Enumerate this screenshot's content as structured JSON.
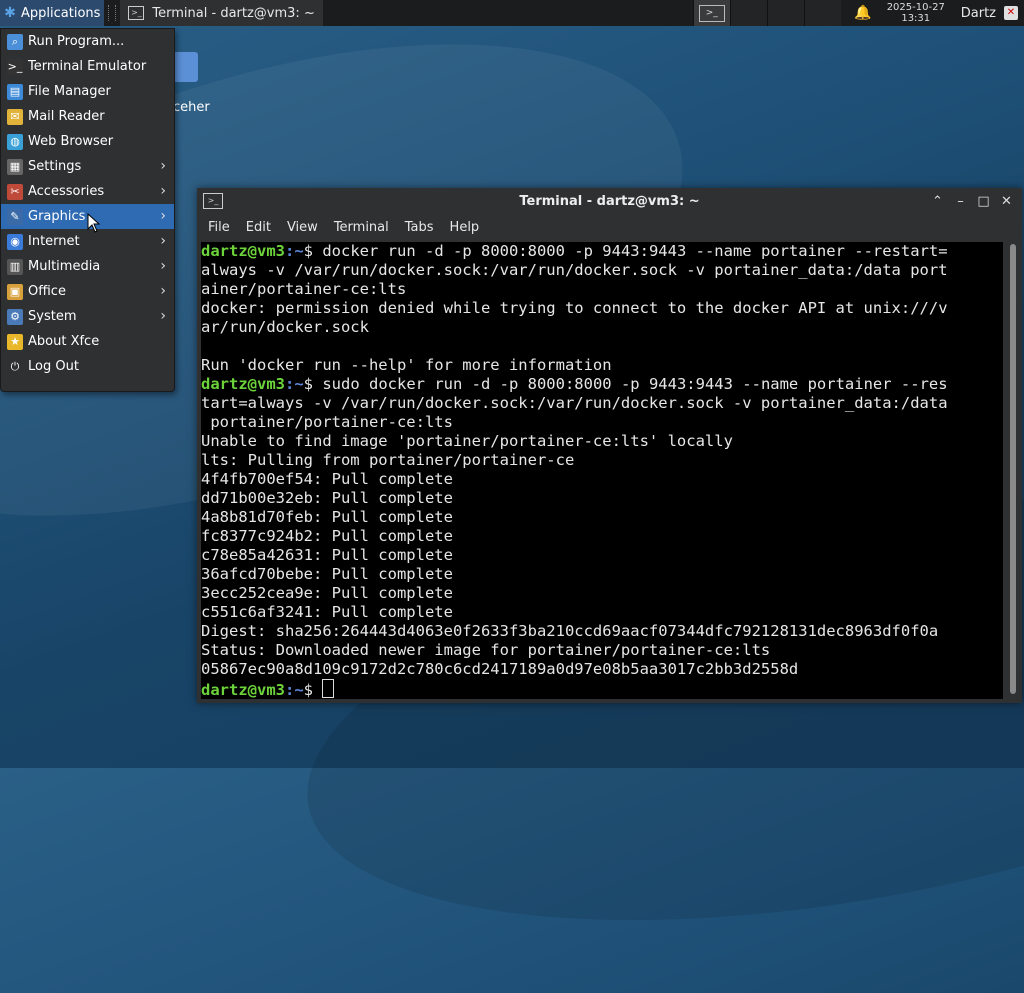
{
  "panel": {
    "applications_label": "Applications",
    "task_label": "Terminal - dartz@vm3: ~",
    "clock_date": "2025-10-27",
    "clock_time": "13:31",
    "user": "Dartz"
  },
  "desktop": {
    "icon_label": "ceher"
  },
  "menu": {
    "items": [
      {
        "label": "Run Program...",
        "icon": "run-icon",
        "submenu": false
      },
      {
        "label": "Terminal Emulator",
        "icon": "terminal-icon",
        "submenu": false
      },
      {
        "label": "File Manager",
        "icon": "file-manager-icon",
        "submenu": false
      },
      {
        "label": "Mail Reader",
        "icon": "mail-icon",
        "submenu": false
      },
      {
        "label": "Web Browser",
        "icon": "browser-icon",
        "submenu": false
      },
      {
        "label": "Settings",
        "icon": "settings-icon",
        "submenu": true
      },
      {
        "label": "Accessories",
        "icon": "accessories-icon",
        "submenu": true
      },
      {
        "label": "Graphics",
        "icon": "graphics-icon",
        "submenu": true,
        "highlighted": true
      },
      {
        "label": "Internet",
        "icon": "internet-icon",
        "submenu": true
      },
      {
        "label": "Multimedia",
        "icon": "multimedia-icon",
        "submenu": true
      },
      {
        "label": "Office",
        "icon": "office-icon",
        "submenu": true
      },
      {
        "label": "System",
        "icon": "system-icon",
        "submenu": true
      },
      {
        "label": "About Xfce",
        "icon": "star-icon",
        "submenu": false
      },
      {
        "label": "Log Out",
        "icon": "logout-icon",
        "submenu": false
      }
    ]
  },
  "terminal": {
    "title": "Terminal - dartz@vm3: ~",
    "menus": [
      "File",
      "Edit",
      "View",
      "Terminal",
      "Tabs",
      "Help"
    ],
    "prompt_user": "dartz@vm3",
    "prompt_path": ":~",
    "prompt_symbol": "$ ",
    "lines": [
      {
        "prompt": true,
        "text": "docker run -d -p 8000:8000 -p 9443:9443 --name portainer --restart="
      },
      {
        "text": "always -v /var/run/docker.sock:/var/run/docker.sock -v portainer_data:/data port"
      },
      {
        "text": "ainer/portainer-ce:lts"
      },
      {
        "text": "docker: permission denied while trying to connect to the docker API at unix:///v"
      },
      {
        "text": "ar/run/docker.sock"
      },
      {
        "text": ""
      },
      {
        "text": "Run 'docker run --help' for more information"
      },
      {
        "prompt": true,
        "text": "sudo docker run -d -p 8000:8000 -p 9443:9443 --name portainer --res"
      },
      {
        "text": "tart=always -v /var/run/docker.sock:/var/run/docker.sock -v portainer_data:/data"
      },
      {
        "text": " portainer/portainer-ce:lts"
      },
      {
        "text": "Unable to find image 'portainer/portainer-ce:lts' locally"
      },
      {
        "text": "lts: Pulling from portainer/portainer-ce"
      },
      {
        "text": "4f4fb700ef54: Pull complete"
      },
      {
        "text": "dd71b00e32eb: Pull complete"
      },
      {
        "text": "4a8b81d70feb: Pull complete"
      },
      {
        "text": "fc8377c924b2: Pull complete"
      },
      {
        "text": "c78e85a42631: Pull complete"
      },
      {
        "text": "36afcd70bebe: Pull complete"
      },
      {
        "text": "3ecc252cea9e: Pull complete"
      },
      {
        "text": "c551c6af3241: Pull complete"
      },
      {
        "text": "Digest: sha256:264443d4063e0f2633f3ba210ccd69aacf07344dfc792128131dec8963df0f0a"
      },
      {
        "text": "Status: Downloaded newer image for portainer/portainer-ce:lts"
      },
      {
        "text": "05867ec90a8d109c9172d2c780c6cd2417189a0d97e08b5aa3017c2bb3d2558d"
      },
      {
        "prompt": true,
        "text": "",
        "cursor": true
      }
    ]
  }
}
